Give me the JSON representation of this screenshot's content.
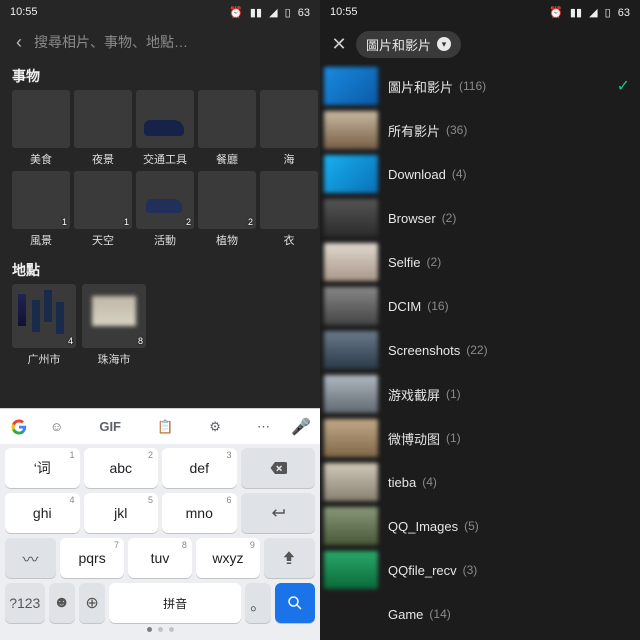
{
  "status": {
    "time": "10:55",
    "battery": "63"
  },
  "left": {
    "search_placeholder": "搜尋相片、事物、地點…",
    "sections": {
      "things": "事物",
      "places": "地點"
    },
    "things_row1": [
      {
        "label": "美食",
        "n": ""
      },
      {
        "label": "夜景",
        "n": ""
      },
      {
        "label": "交通工具",
        "n": ""
      },
      {
        "label": "餐廳",
        "n": ""
      },
      {
        "label": "海",
        "n": ""
      }
    ],
    "things_row2": [
      {
        "label": "風景",
        "n": "1"
      },
      {
        "label": "天空",
        "n": "1"
      },
      {
        "label": "活動",
        "n": "2"
      },
      {
        "label": "植物",
        "n": "2"
      },
      {
        "label": "衣",
        "n": ""
      }
    ],
    "places": [
      {
        "label": "广州市",
        "n": "4"
      },
      {
        "label": "珠海市",
        "n": "8"
      }
    ],
    "keyboard": {
      "toolbar": {
        "gif": "GIF"
      },
      "row1": [
        {
          "main": "‘词",
          "sup": "1"
        },
        {
          "main": "abc",
          "sup": "2"
        },
        {
          "main": "def",
          "sup": "3"
        }
      ],
      "row2": [
        {
          "main": "ghi",
          "sup": "4"
        },
        {
          "main": "jkl",
          "sup": "5"
        },
        {
          "main": "mno",
          "sup": "6"
        }
      ],
      "row3": [
        {
          "main": "pqrs",
          "sup": "7"
        },
        {
          "main": "tuv",
          "sup": "8"
        },
        {
          "main": "wxyz",
          "sup": "9"
        }
      ],
      "symkey": "?123",
      "space": "拼音",
      "period": "。"
    }
  },
  "right": {
    "chip": "圖片和影片",
    "folders": [
      {
        "name": "圖片和影片",
        "count": "(116)",
        "selected": true
      },
      {
        "name": "所有影片",
        "count": "(36)"
      },
      {
        "name": "Download",
        "count": "(4)"
      },
      {
        "name": "Browser",
        "count": "(2)"
      },
      {
        "name": "Selfie",
        "count": "(2)"
      },
      {
        "name": "DCIM",
        "count": "(16)"
      },
      {
        "name": "Screenshots",
        "count": "(22)"
      },
      {
        "name": "游戏截屏",
        "count": "(1)"
      },
      {
        "name": "微博动图",
        "count": "(1)"
      },
      {
        "name": "tieba",
        "count": "(4)"
      },
      {
        "name": "QQ_Images",
        "count": "(5)"
      },
      {
        "name": "QQfile_recv",
        "count": "(3)"
      },
      {
        "name": "Game",
        "count": "(14)"
      }
    ]
  }
}
